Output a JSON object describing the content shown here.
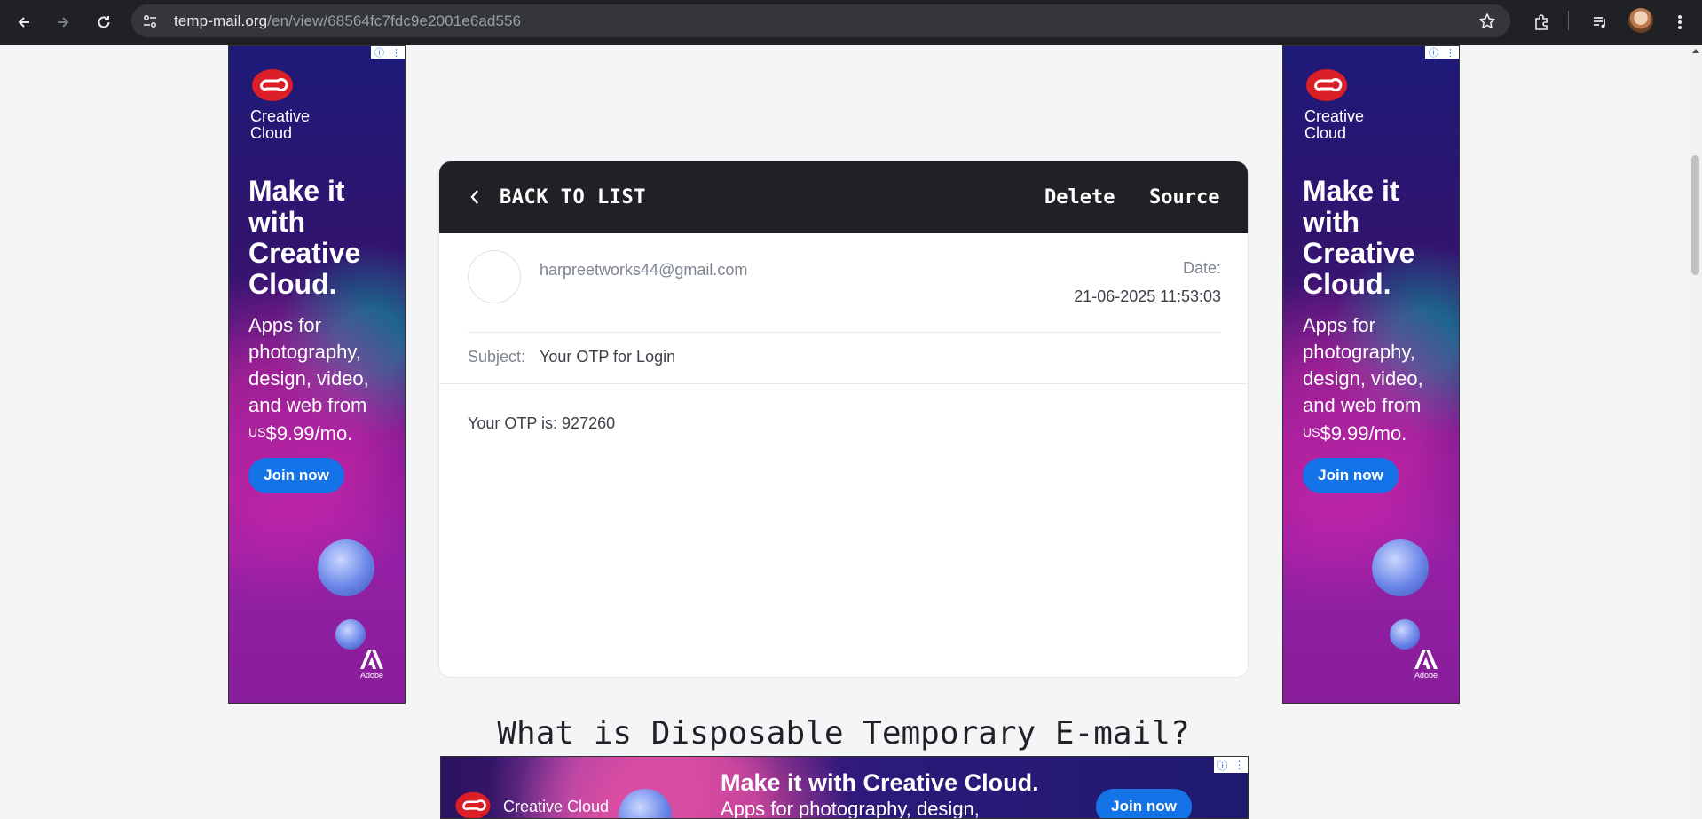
{
  "browser": {
    "url_host": "temp-mail.org",
    "url_path": "/en/view/68564fc7fdc9e2001e6ad556"
  },
  "side_ad": {
    "brand": "Creative\nCloud",
    "headline": "Make it with Creative Cloud.",
    "copy": "Apps for photography, design, video, and web from",
    "price_prefix": "US",
    "price": "$9.99/mo.",
    "cta": "Join now",
    "adobe": "Adobe",
    "colors": {
      "cta": "#1473e6",
      "logo_red": "#da1f26"
    }
  },
  "mail": {
    "back_label": "BACK TO LIST",
    "delete_label": "Delete",
    "source_label": "Source",
    "sender_email": "harpreetworks44@gmail.com",
    "date_label": "Date:",
    "date_value": "21-06-2025 11:53:03",
    "subject_label": "Subject:",
    "subject_value": "Your OTP for Login",
    "body": "Your OTP is: 927260",
    "header_color": "#1f2124"
  },
  "section": {
    "heading": "What is Disposable Temporary E-mail?"
  },
  "banner_ad": {
    "brand": "Creative Cloud",
    "headline": "Make it with Creative Cloud.",
    "copy": "Apps for photography, design,",
    "cta": "Join now"
  }
}
